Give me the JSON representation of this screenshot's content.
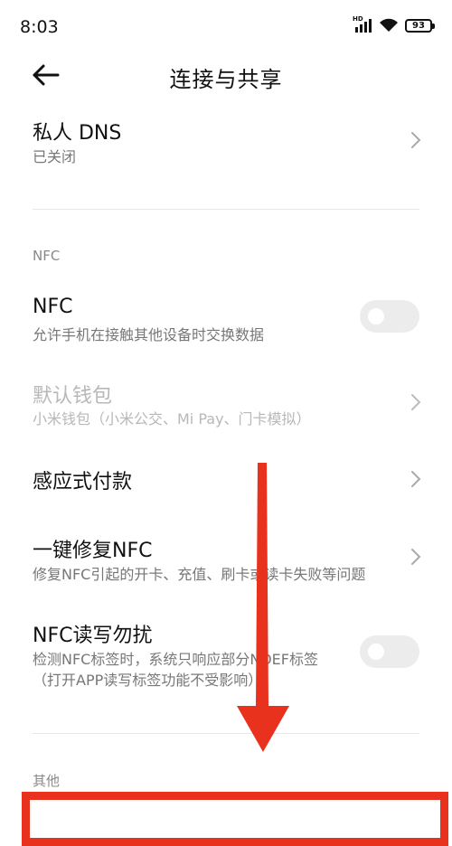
{
  "status_bar": {
    "time": "8:03",
    "network_label": "HD",
    "battery": "93"
  },
  "header": {
    "title": "连接与共享",
    "back_icon": "arrow-left-icon"
  },
  "rows": {
    "private_dns": {
      "title": "私人 DNS",
      "subtitle": "已关闭"
    },
    "nfc_section_label": "NFC",
    "nfc": {
      "title": "NFC",
      "subtitle": "允许手机在接触其他设备时交换数据",
      "toggle_on": false
    },
    "default_wallet": {
      "title": "默认钱包",
      "subtitle": "小米钱包（小米公交、Mi Pay、门卡模拟）",
      "enabled": false
    },
    "sensing_payment": {
      "title": "感应式付款"
    },
    "fix_nfc": {
      "title": "一键修复NFC",
      "subtitle": "修复NFC引起的开卡、充值、刷卡或读卡失败等问题"
    },
    "nfc_dnd": {
      "title": "NFC读写勿扰",
      "subtitle_line1": "检测NFC标签时，系统只响应部分NDEF标签",
      "subtitle_line2": "（打开APP读写标签功能不受影响）",
      "toggle_on": false
    },
    "other_section_label": "其他"
  },
  "annotation": {
    "arrow_color": "#e8321e",
    "box_color": "#e8321e"
  }
}
